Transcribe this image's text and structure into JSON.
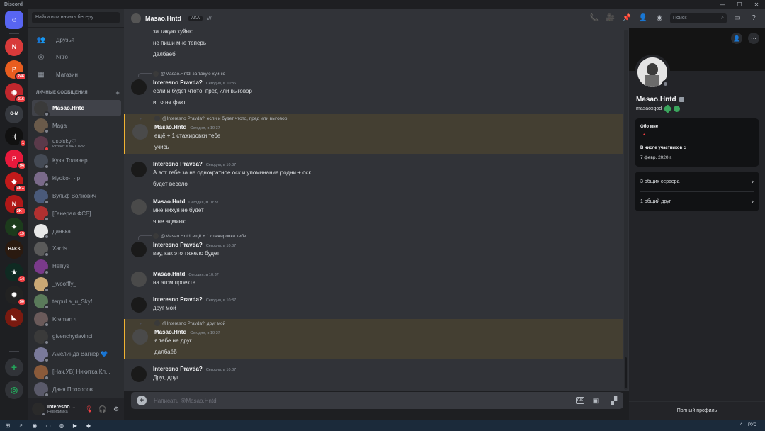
{
  "window": {
    "title": "Discord",
    "controls": [
      "—",
      "☐",
      "✕"
    ]
  },
  "servers": [
    {
      "name": "Home",
      "kind": "home",
      "color": "#5865f2",
      "badge": ""
    },
    {
      "name": "",
      "color": "#d83a3a",
      "badge": "",
      "glyph": "N"
    },
    {
      "name": "",
      "color": "#e85d1f",
      "badge": "246",
      "glyph": "P"
    },
    {
      "name": "",
      "color": "#c1272d",
      "badge": "216",
      "glyph": "◉"
    },
    {
      "name": "",
      "color": "#36393f",
      "badge": "",
      "glyph": "G-M"
    },
    {
      "name": "",
      "color": "#111111",
      "badge": "1",
      "glyph": ":("
    },
    {
      "name": "",
      "color": "#e8193c",
      "badge": "94",
      "glyph": "P"
    },
    {
      "name": "",
      "color": "#c11a1a",
      "badge": "4K+",
      "glyph": "◆"
    },
    {
      "name": "",
      "color": "#b11818",
      "badge": "2K+",
      "glyph": "N"
    },
    {
      "name": "",
      "color": "#1c3b1c",
      "badge": "19",
      "glyph": "✦"
    },
    {
      "name": "",
      "color": "#2a1a10",
      "badge": "",
      "glyph": "HAKS"
    },
    {
      "name": "",
      "color": "#0f2a22",
      "badge": "14",
      "glyph": "★"
    },
    {
      "name": "",
      "color": "#222222",
      "badge": "50",
      "glyph": "✺"
    },
    {
      "name": "",
      "color": "#7a1a10",
      "badge": "",
      "glyph": "◣"
    }
  ],
  "rail_actions": {
    "add": "+",
    "explore": "◎"
  },
  "sidebar": {
    "search_placeholder": "Найти или начать беседу",
    "nav": [
      {
        "label": "Друзья",
        "icon": "friends-icon",
        "glyph": "👥"
      },
      {
        "label": "Nitro",
        "icon": "nitro-icon",
        "glyph": "◎"
      },
      {
        "label": "Магазин",
        "icon": "shop-icon",
        "glyph": "▦"
      }
    ],
    "dm_header": "ЛИЧНЫЕ СООБЩЕНИЯ",
    "dm_plus": "+",
    "dms": [
      {
        "name": "Masao.Hntd",
        "status": "off",
        "color": "#3a3a3a",
        "active": true,
        "sub": ""
      },
      {
        "name": "Maga",
        "status": "off",
        "color": "#6a5a4a",
        "sub": ""
      },
      {
        "name": "usolsky♡",
        "status": "dnd",
        "color": "#5a3a4a",
        "sub": "Играет в NEXTRP"
      },
      {
        "name": "Кузя Толивер",
        "status": "off",
        "color": "#444a55",
        "sub": ""
      },
      {
        "name": "kiyoko-_-ıp",
        "status": "off",
        "color": "#7a6a8a",
        "sub": ""
      },
      {
        "name": "Вульф Волкович",
        "status": "off",
        "color": "#4a5a7a",
        "sub": ""
      },
      {
        "name": "[Генерал ФСБ]",
        "status": "off",
        "color": "#b03030",
        "sub": ""
      },
      {
        "name": "данька",
        "status": "off",
        "color": "#e8e8e8",
        "sub": ""
      },
      {
        "name": "Xarris",
        "status": "off",
        "color": "#5a5a5a",
        "sub": ""
      },
      {
        "name": "Helliys",
        "status": "off",
        "color": "#7a3a8a",
        "sub": ""
      },
      {
        "name": "_woofffy_",
        "status": "off",
        "color": "#caa875",
        "sub": ""
      },
      {
        "name": "terpuLa_u_Skyf",
        "status": "off",
        "color": "#5a7a5a",
        "sub": ""
      },
      {
        "name": "Kreman ᛃ",
        "status": "off",
        "color": "#6a5a5a",
        "sub": ""
      },
      {
        "name": "givenchydavinci",
        "status": "off",
        "color": "#3a3a3a",
        "sub": ""
      },
      {
        "name": "Амелинда Вагнер 💙",
        "status": "off",
        "color": "#7a7a9a",
        "sub": ""
      },
      {
        "name": "[Нач.УВ] Никитка Кл...",
        "status": "off",
        "color": "#8a5a3a",
        "sub": ""
      },
      {
        "name": "Даня Прохоров",
        "status": "off",
        "color": "#5a5a6a",
        "sub": ""
      }
    ]
  },
  "user_panel": {
    "name": "Interesno ...",
    "status": "Невидимка",
    "mute_glyph": "🎙",
    "deafen_glyph": "🎧",
    "settings_glyph": "⚙"
  },
  "chat_header": {
    "name": "Masao.Hntd",
    "aka": "AKA",
    "aka_extra": "///",
    "search_placeholder": "Поиск",
    "icons": [
      "📞",
      "🎥",
      "📌",
      "👤",
      "◉"
    ]
  },
  "messages": [
    {
      "author": "",
      "ts": "",
      "lines": [
        "за такую хуйню",
        "не пиши мне теперь",
        "далбаёб"
      ],
      "cont": true
    },
    {
      "reply": {
        "name": "@Masao.Hntd",
        "text": "за такую хуйню"
      },
      "author": "Interesno Pravda?",
      "ts": "Сегодня, в 10:36",
      "lines": [
        "если и будет чтото, пред или выговор",
        "и то не факт"
      ]
    },
    {
      "reply": {
        "name": "@Interesno Pravda?",
        "text": "если и будет чтото, пред или выговор"
      },
      "author": "Masao.Hntd",
      "ts": "Сегодня, в 10:37",
      "lines": [
        "ещё + 1 стажировки тебе",
        "учись"
      ],
      "hl": true
    },
    {
      "author": "Interesno Pravda?",
      "ts": "Сегодня, в 10:37",
      "lines": [
        "А вот тебе за не однократное оск и упоминание родни + оск",
        "будет весело"
      ]
    },
    {
      "author": "Masao.Hntd",
      "ts": "Сегодня, в 10:37",
      "lines": [
        "мне нихуя не будет",
        "я не админю"
      ]
    },
    {
      "reply": {
        "name": "@Masao.Hntd",
        "text": "ещё + 1 стажировки тебе"
      },
      "author": "Interesno Pravda?",
      "ts": "Сегодня, в 10:37",
      "lines": [
        "вау, как это тяжело будет"
      ]
    },
    {
      "author": "Masao.Hntd",
      "ts": "Сегодня, в 10:37",
      "lines": [
        "на этом проекте"
      ]
    },
    {
      "author": "Interesno Pravda?",
      "ts": "Сегодня, в 10:37",
      "lines": [
        "друг мой"
      ]
    },
    {
      "reply": {
        "name": "@Interesno Pravda?",
        "text": "друг мой"
      },
      "author": "Masao.Hntd",
      "ts": "Сегодня, в 10:37",
      "lines": [
        "я тебе не друг",
        "далбаёб"
      ],
      "hl": true
    },
    {
      "author": "Interesno Pravda?",
      "ts": "Сегодня, в 10:37",
      "lines": [
        "Друг, друг"
      ]
    }
  ],
  "composer": {
    "placeholder": "Написать @Masao.Hntd",
    "plus": "+",
    "gif": "GIF",
    "sticker": "▣",
    "emoji": "☺",
    "apps": "▞"
  },
  "profile": {
    "display_name": "Masao.Hntd",
    "username": "masaoxgod",
    "about_label": "Обо мне",
    "about_value": "•",
    "member_since_label": "В числе участников с",
    "member_since_value": "7 февр. 2020 г.",
    "mutual_servers": "3 общих сервера",
    "mutual_friends": "1 общий друг",
    "full_profile": "Полный профиль",
    "top_icons": [
      "👤",
      "⋯"
    ]
  },
  "taskbar": {
    "icons": [
      "⊞",
      "⌕",
      "◉",
      "▭",
      "◍",
      "▶",
      "◆"
    ],
    "tray_lang": "РУС",
    "tray_icon": "^"
  }
}
